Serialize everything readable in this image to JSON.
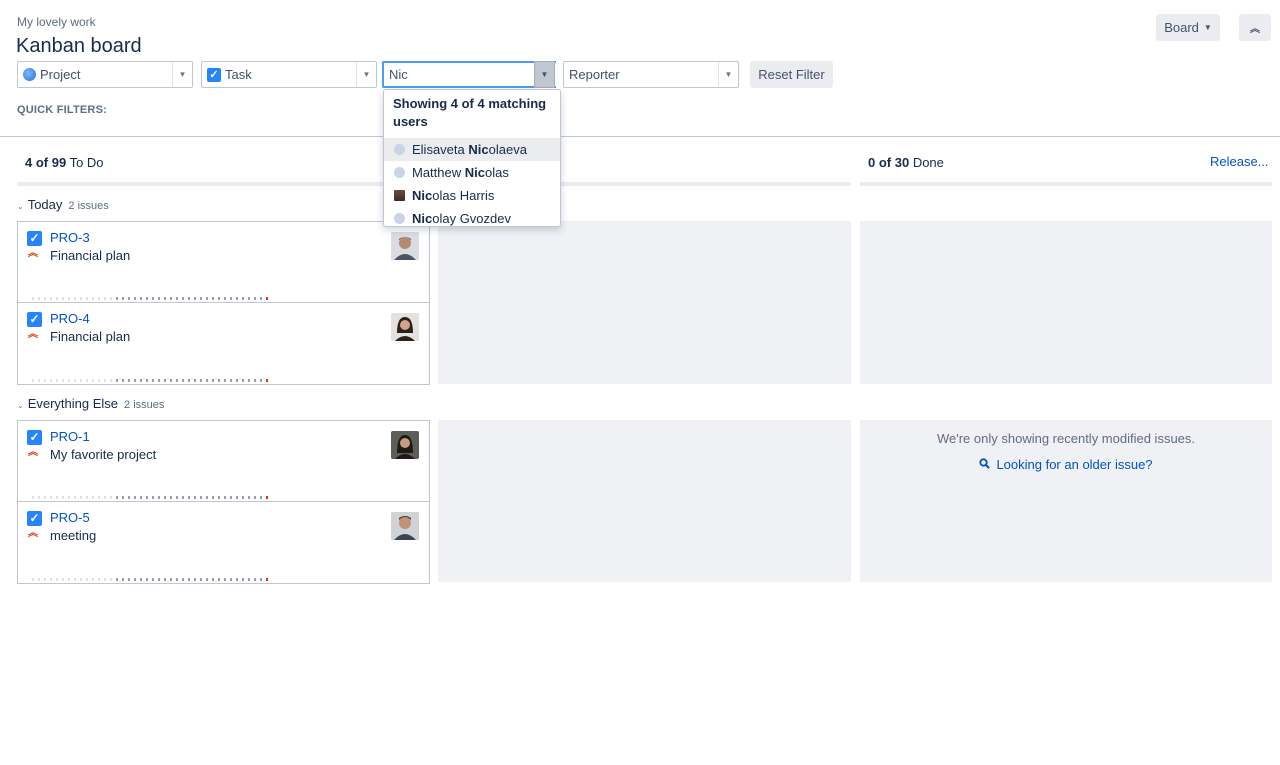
{
  "header": {
    "breadcrumb": "My lovely work",
    "title": "Kanban board",
    "board_button": "Board",
    "collapse_icon": "chevrons-up-icon"
  },
  "filters": {
    "project": "Project",
    "task": "Task",
    "assignee_value": "Nic",
    "reporter": "Reporter",
    "reset": "Reset Filter",
    "quick_filters_label": "QUICK FILTERS:"
  },
  "dropdown": {
    "heading": "Showing 4 of 4 matching users",
    "match": "Nic",
    "items": [
      {
        "bold": "Nic",
        "rest_pre": "Elisaveta ",
        "rest_post": "olaeva",
        "active": true
      },
      {
        "bold": "Nic",
        "rest_pre": "Matthew ",
        "rest_post": "olas",
        "active": false
      },
      {
        "bold": "Nic",
        "rest_pre": "",
        "rest_post": "olas Harris",
        "active": false
      },
      {
        "bold": "Nic",
        "rest_pre": "",
        "rest_post": "olay Gvozdev",
        "active": false
      }
    ]
  },
  "columns": {
    "todo": {
      "count": "4 of 99",
      "name": "To Do"
    },
    "done": {
      "count": "0 of 30",
      "name": "Done"
    },
    "release_link": "Release..."
  },
  "swimlanes": [
    {
      "name": "Today",
      "count": "2 issues"
    },
    {
      "name": "Everything Else",
      "count": "2 issues"
    }
  ],
  "cards": [
    {
      "key": "PRO-3",
      "summary": "Financial plan"
    },
    {
      "key": "PRO-4",
      "summary": "Financial plan"
    },
    {
      "key": "PRO-1",
      "summary": "My favorite project"
    },
    {
      "key": "PRO-5",
      "summary": "meeting"
    }
  ],
  "older": {
    "message": "We're only showing recently modified issues.",
    "link": "Looking for an older issue?"
  },
  "colors": {
    "link": "#0052cc",
    "accent": "#2684ff",
    "priority": "#de350b",
    "column_bg": "#f0f1f5"
  }
}
